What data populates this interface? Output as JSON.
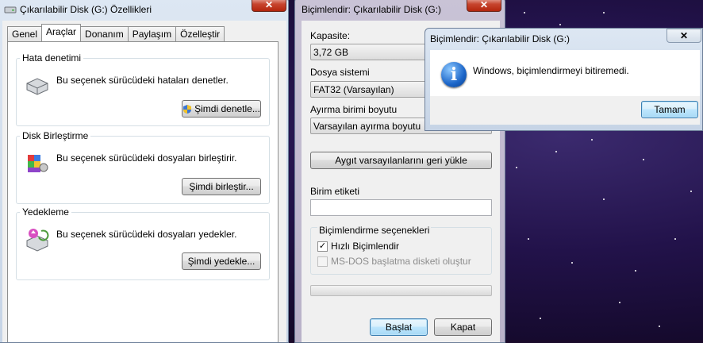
{
  "properties": {
    "title": "Çıkarılabilir Disk (G:) Özellikleri",
    "tabs": [
      "Genel",
      "Araçlar",
      "Donanım",
      "Paylaşım",
      "Özelleştir"
    ],
    "active_tab": "Araçlar",
    "groups": {
      "error_check": {
        "title": "Hata denetimi",
        "text": "Bu seçenek sürücüdeki hataları denetler.",
        "button": "Şimdi denetle..."
      },
      "defrag": {
        "title": "Disk Birleştirme",
        "text": "Bu seçenek sürücüdeki dosyaları birleştirir.",
        "button": "Şimdi birleştir..."
      },
      "backup": {
        "title": "Yedekleme",
        "text": "Bu seçenek sürücüdeki dosyaları yedekler.",
        "button": "Şimdi yedekle..."
      }
    }
  },
  "format": {
    "title": "Biçimlendir: Çıkarılabilir Disk (G:)",
    "capacity_label": "Kapasite:",
    "capacity_value": "3,72 GB",
    "filesystem_label": "Dosya sistemi",
    "filesystem_value": "FAT32 (Varsayılan)",
    "allocation_label": "Ayırma birimi boyutu",
    "allocation_value": "Varsayılan ayırma boyutu",
    "restore_button": "Aygıt varsayılanlarını geri yükle",
    "volume_label": "Birim etiketi",
    "volume_value": "",
    "options_title": "Biçimlendirme seçenekleri",
    "quick_format": "Hızlı Biçimlendir",
    "quick_format_checked": true,
    "msdos_disk": "MS-DOS başlatma disketi oluştur",
    "msdos_checked": false,
    "start_button": "Başlat",
    "close_button": "Kapat"
  },
  "message": {
    "title": "Biçimlendir: Çıkarılabilir Disk (G:)",
    "text": "Windows, biçimlendirmeyi bitiremedi.",
    "ok_button": "Tamam",
    "icon": "info-icon"
  },
  "close_glyph": "✕"
}
